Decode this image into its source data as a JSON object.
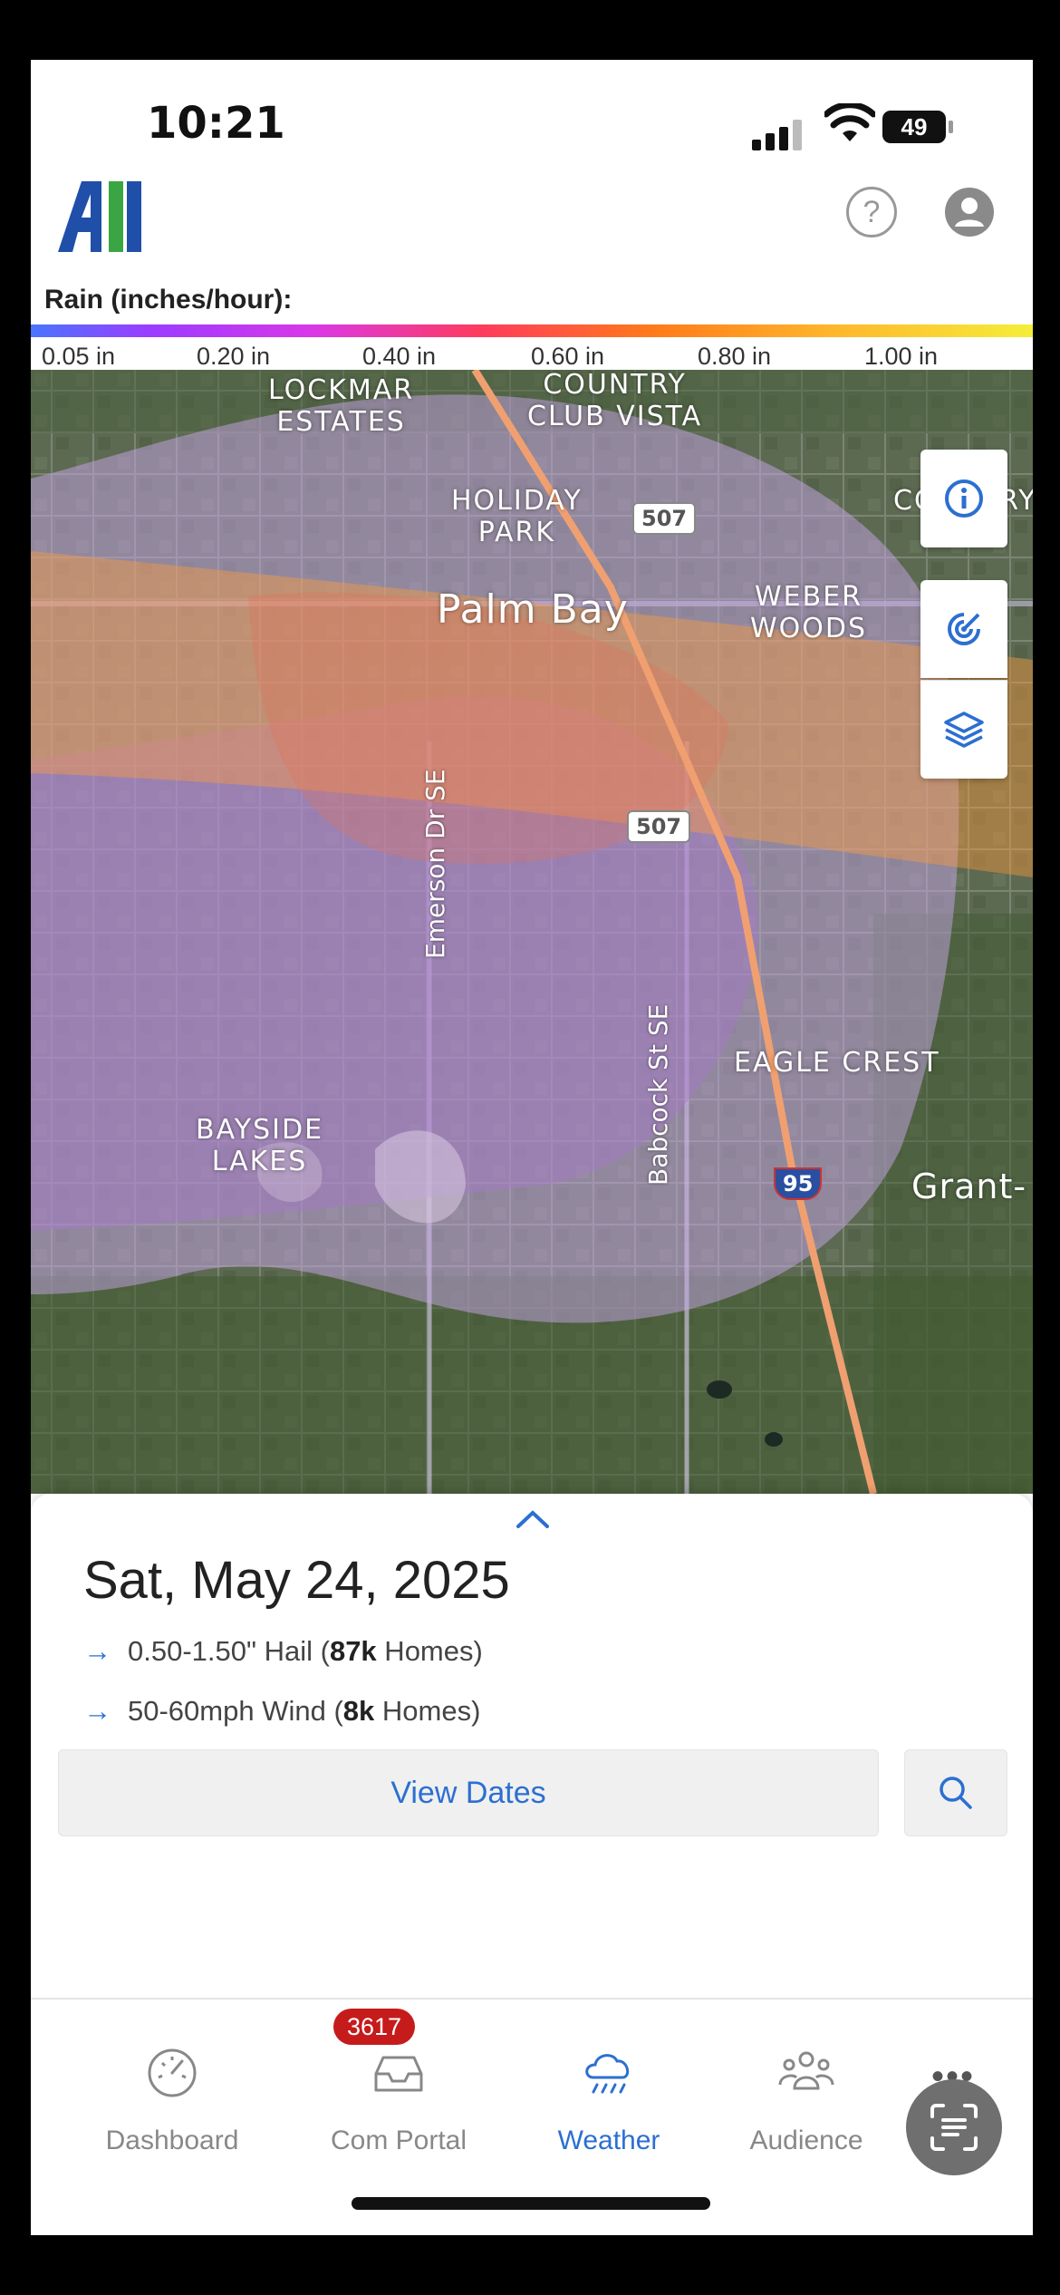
{
  "status": {
    "time": "10:21",
    "battery": "49"
  },
  "header": {
    "logo_text": "AI"
  },
  "legend": {
    "title": "Rain (inches/hour):",
    "ticks": [
      "0.05 in",
      "0.20 in",
      "0.40 in",
      "0.60 in",
      "0.80 in",
      "1.00 in"
    ]
  },
  "map": {
    "labels": {
      "lockmar": "LOCKMAR\nESTATES",
      "country_club": "COUNTRY\nCLUB VISTA",
      "country": "COUNTRY",
      "holiday": "HOLIDAY\nPARK",
      "palm_bay": "Palm Bay",
      "weber": "WEBER\nWOODS",
      "eagle": "EAGLE CREST",
      "bayside": "BAYSIDE\nLAKES",
      "grant": "Grant-",
      "emerson": "Emerson Dr SE",
      "babcock": "Babcock St SE",
      "shield_507a": "507",
      "shield_507b": "507",
      "shield_95": "95"
    }
  },
  "panel": {
    "date": "Sat, May 24, 2025",
    "events": [
      {
        "prefix": "0.50-1.50\" Hail  (",
        "bold": "87k",
        "suffix": " Homes)"
      },
      {
        "prefix": "50-60mph Wind  (",
        "bold": "8k",
        "suffix": " Homes)"
      }
    ],
    "view_dates_label": "View Dates"
  },
  "nav": {
    "items": [
      {
        "label": "Dashboard",
        "icon": "speedometer-icon"
      },
      {
        "label": "Com Portal",
        "icon": "inbox-icon"
      },
      {
        "label": "Weather",
        "icon": "cloud-rain-icon"
      },
      {
        "label": "Audience",
        "icon": "people-icon"
      }
    ],
    "badge": "3617",
    "active": "Weather"
  },
  "colors": {
    "accent": "#2c6fd1",
    "badge": "#c61b1b",
    "hail_purple": "#b58ad6",
    "wind_orange": "#f0a040"
  }
}
